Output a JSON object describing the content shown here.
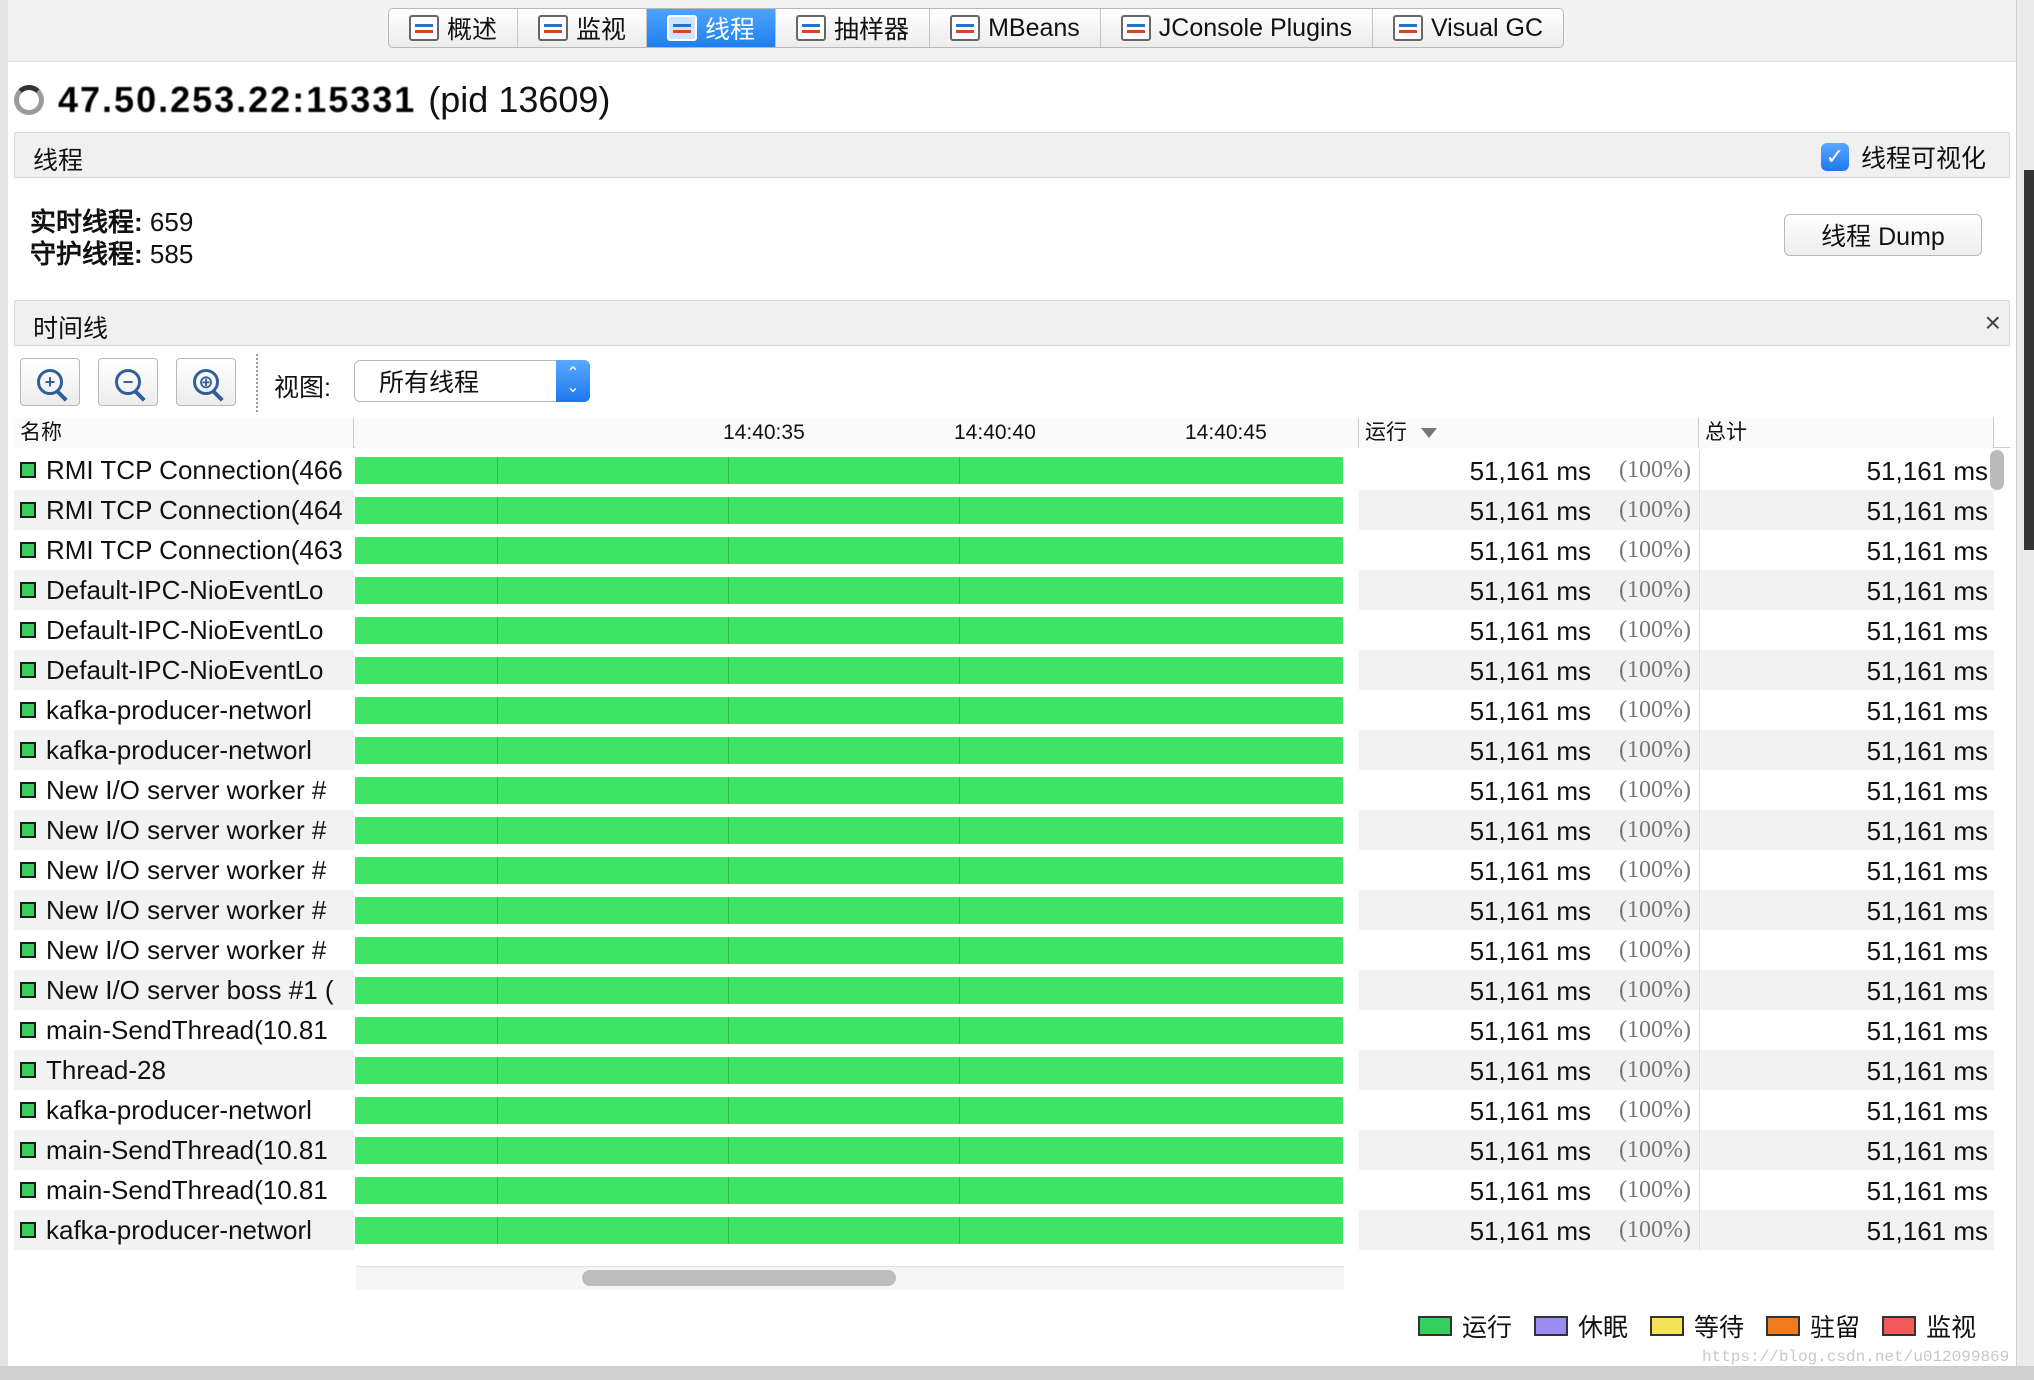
{
  "tabs": [
    {
      "label": "概述",
      "icon": "overview-icon",
      "active": false
    },
    {
      "label": "监视",
      "icon": "monitor-chart-icon",
      "active": false
    },
    {
      "label": "线程",
      "icon": "threads-icon",
      "active": true
    },
    {
      "label": "抽样器",
      "icon": "sampler-icon",
      "active": false
    },
    {
      "label": "MBeans",
      "icon": "mbeans-icon",
      "active": false
    },
    {
      "label": "JConsole Plugins",
      "icon": "jconsole-plugins-icon",
      "active": false
    },
    {
      "label": "Visual GC",
      "icon": "visual-gc-icon",
      "active": false
    }
  ],
  "process": {
    "host": "47.50.253.22:15331",
    "pid_label": "(pid 13609)"
  },
  "threads_section": {
    "title": "线程",
    "visualize_label": "线程可视化",
    "visualize_checked": true,
    "live_label": "实时线程:",
    "live_value": "659",
    "daemon_label": "守护线程:",
    "daemon_value": "585",
    "dump_label": "线程 Dump"
  },
  "timeline_section": {
    "title": "时间线",
    "close_glyph": "×",
    "view_label": "视图:",
    "view_value": "所有线程",
    "zoom_in_glyph": "+",
    "zoom_out_glyph": "−",
    "zoom_fit_glyph": "⊕"
  },
  "table": {
    "columns": {
      "name": "名称",
      "run": "运行",
      "total": "总计"
    },
    "ticks": [
      "14:40:35",
      "14:40:40",
      "14:40:45"
    ],
    "rows": [
      {
        "name": "RMI TCP Connection(466",
        "run": "51,161 ms",
        "pct": "(100%)",
        "total": "51,161 ms"
      },
      {
        "name": "RMI TCP Connection(464",
        "run": "51,161 ms",
        "pct": "(100%)",
        "total": "51,161 ms"
      },
      {
        "name": "RMI TCP Connection(463",
        "run": "51,161 ms",
        "pct": "(100%)",
        "total": "51,161 ms"
      },
      {
        "name": "Default-IPC-NioEventLo",
        "run": "51,161 ms",
        "pct": "(100%)",
        "total": "51,161 ms"
      },
      {
        "name": "Default-IPC-NioEventLo",
        "run": "51,161 ms",
        "pct": "(100%)",
        "total": "51,161 ms"
      },
      {
        "name": "Default-IPC-NioEventLo",
        "run": "51,161 ms",
        "pct": "(100%)",
        "total": "51,161 ms"
      },
      {
        "name": "kafka-producer-networl",
        "run": "51,161 ms",
        "pct": "(100%)",
        "total": "51,161 ms"
      },
      {
        "name": "kafka-producer-networl",
        "run": "51,161 ms",
        "pct": "(100%)",
        "total": "51,161 ms"
      },
      {
        "name": "New I/O server worker #",
        "run": "51,161 ms",
        "pct": "(100%)",
        "total": "51,161 ms"
      },
      {
        "name": "New I/O server worker #",
        "run": "51,161 ms",
        "pct": "(100%)",
        "total": "51,161 ms"
      },
      {
        "name": "New I/O server worker #",
        "run": "51,161 ms",
        "pct": "(100%)",
        "total": "51,161 ms"
      },
      {
        "name": "New I/O server worker #",
        "run": "51,161 ms",
        "pct": "(100%)",
        "total": "51,161 ms"
      },
      {
        "name": "New I/O server worker #",
        "run": "51,161 ms",
        "pct": "(100%)",
        "total": "51,161 ms"
      },
      {
        "name": "New I/O server boss #1 (",
        "run": "51,161 ms",
        "pct": "(100%)",
        "total": "51,161 ms"
      },
      {
        "name": "main-SendThread(10.81",
        "run": "51,161 ms",
        "pct": "(100%)",
        "total": "51,161 ms"
      },
      {
        "name": "Thread-28",
        "run": "51,161 ms",
        "pct": "(100%)",
        "total": "51,161 ms"
      },
      {
        "name": "kafka-producer-networl",
        "run": "51,161 ms",
        "pct": "(100%)",
        "total": "51,161 ms"
      },
      {
        "name": "main-SendThread(10.81",
        "run": "51,161 ms",
        "pct": "(100%)",
        "total": "51,161 ms"
      },
      {
        "name": "main-SendThread(10.81",
        "run": "51,161 ms",
        "pct": "(100%)",
        "total": "51,161 ms"
      },
      {
        "name": "kafka-producer-networl",
        "run": "51,161 ms",
        "pct": "(100%)",
        "total": "51,161 ms"
      }
    ]
  },
  "legend": [
    {
      "label": "运行",
      "color": "#34d05b"
    },
    {
      "label": "休眠",
      "color": "#9a8cf0"
    },
    {
      "label": "等待",
      "color": "#f5e25a"
    },
    {
      "label": "驻留",
      "color": "#f07a1c"
    },
    {
      "label": "监视",
      "color": "#f05a5a"
    }
  ],
  "watermark": "https://blog.csdn.net/u012099869"
}
